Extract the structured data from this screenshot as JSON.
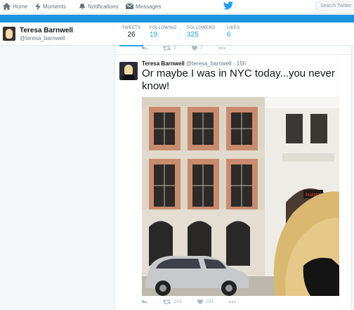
{
  "nav": {
    "home": "Home",
    "moments": "Moments",
    "notifications": "Notifications",
    "notifications_badge": "",
    "messages": "Messages",
    "search_placeholder": "Search Twitter"
  },
  "profile": {
    "name": "Teresa Barnwell",
    "handle": "@teresa_barnwell",
    "stats": [
      {
        "label": "TWEETS",
        "value": "26"
      },
      {
        "label": "FOLLOWING",
        "value": "19"
      },
      {
        "label": "FOLLOWERS",
        "value": "325"
      },
      {
        "label": "LIKES",
        "value": "6"
      }
    ]
  },
  "prev_tweet": {
    "retweets": "2",
    "likes": "7"
  },
  "tweet": {
    "name": "Teresa Barnwell",
    "handle": "@teresa_barnwell",
    "time": "15h",
    "text": "Or maybe I was in NYC today...you never know!",
    "photo_sign": "buzzini",
    "retweets": "243",
    "likes": "181"
  },
  "colors": {
    "accent": "#1da1f2",
    "banner": "#1b95e0"
  }
}
